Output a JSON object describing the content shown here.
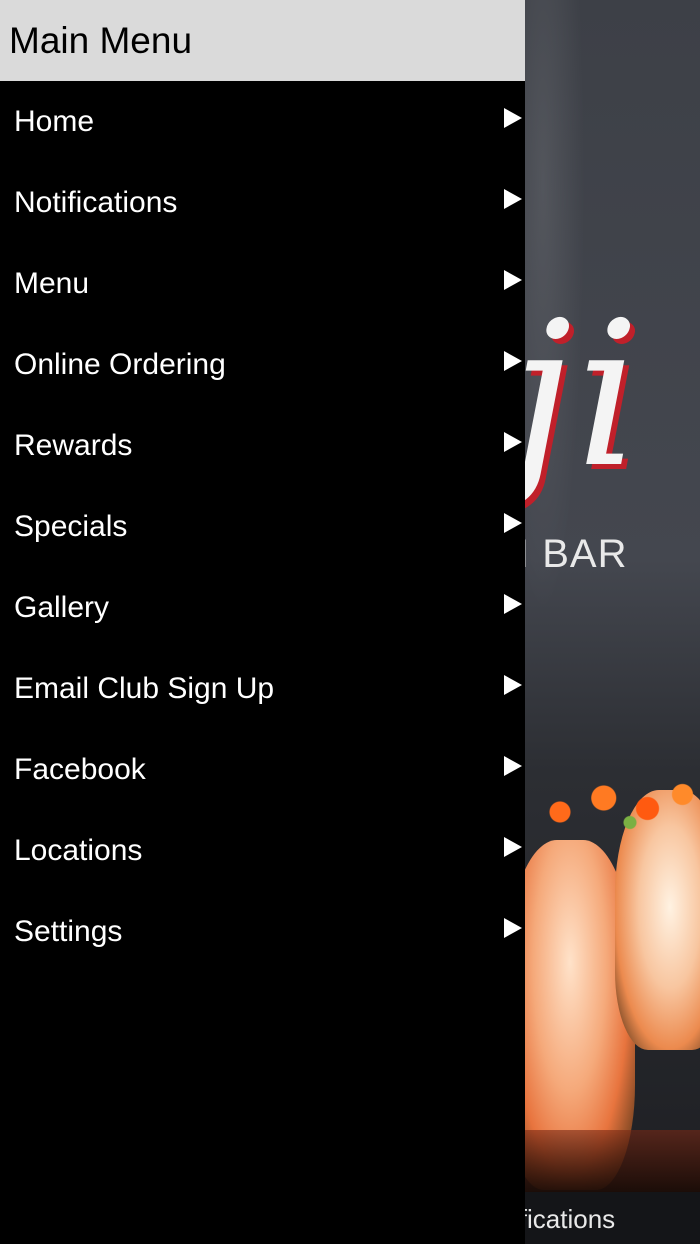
{
  "drawer": {
    "title": "Main Menu",
    "items": [
      {
        "label": "Home",
        "icon": "chevron-right-icon"
      },
      {
        "label": "Notifications",
        "icon": "chevron-right-icon"
      },
      {
        "label": "Menu",
        "icon": "chevron-right-icon"
      },
      {
        "label": "Online Ordering",
        "icon": "chevron-right-icon"
      },
      {
        "label": "Rewards",
        "icon": "chevron-right-icon"
      },
      {
        "label": "Specials",
        "icon": "chevron-right-icon"
      },
      {
        "label": "Gallery",
        "icon": "chevron-right-icon"
      },
      {
        "label": "Email Club Sign Up",
        "icon": "chevron-right-icon"
      },
      {
        "label": "Facebook",
        "icon": "chevron-right-icon"
      },
      {
        "label": "Locations",
        "icon": "chevron-right-icon"
      },
      {
        "label": "Settings",
        "icon": "chevron-right-icon"
      }
    ]
  },
  "background": {
    "logo_text": "ji",
    "logo_subtitle": "I BAR",
    "tab_label": "ifications"
  },
  "colors": {
    "drawer_bg": "#000000",
    "header_bg": "#dadada",
    "menu_text": "#ffffff",
    "logo_accent": "#c0202a"
  }
}
